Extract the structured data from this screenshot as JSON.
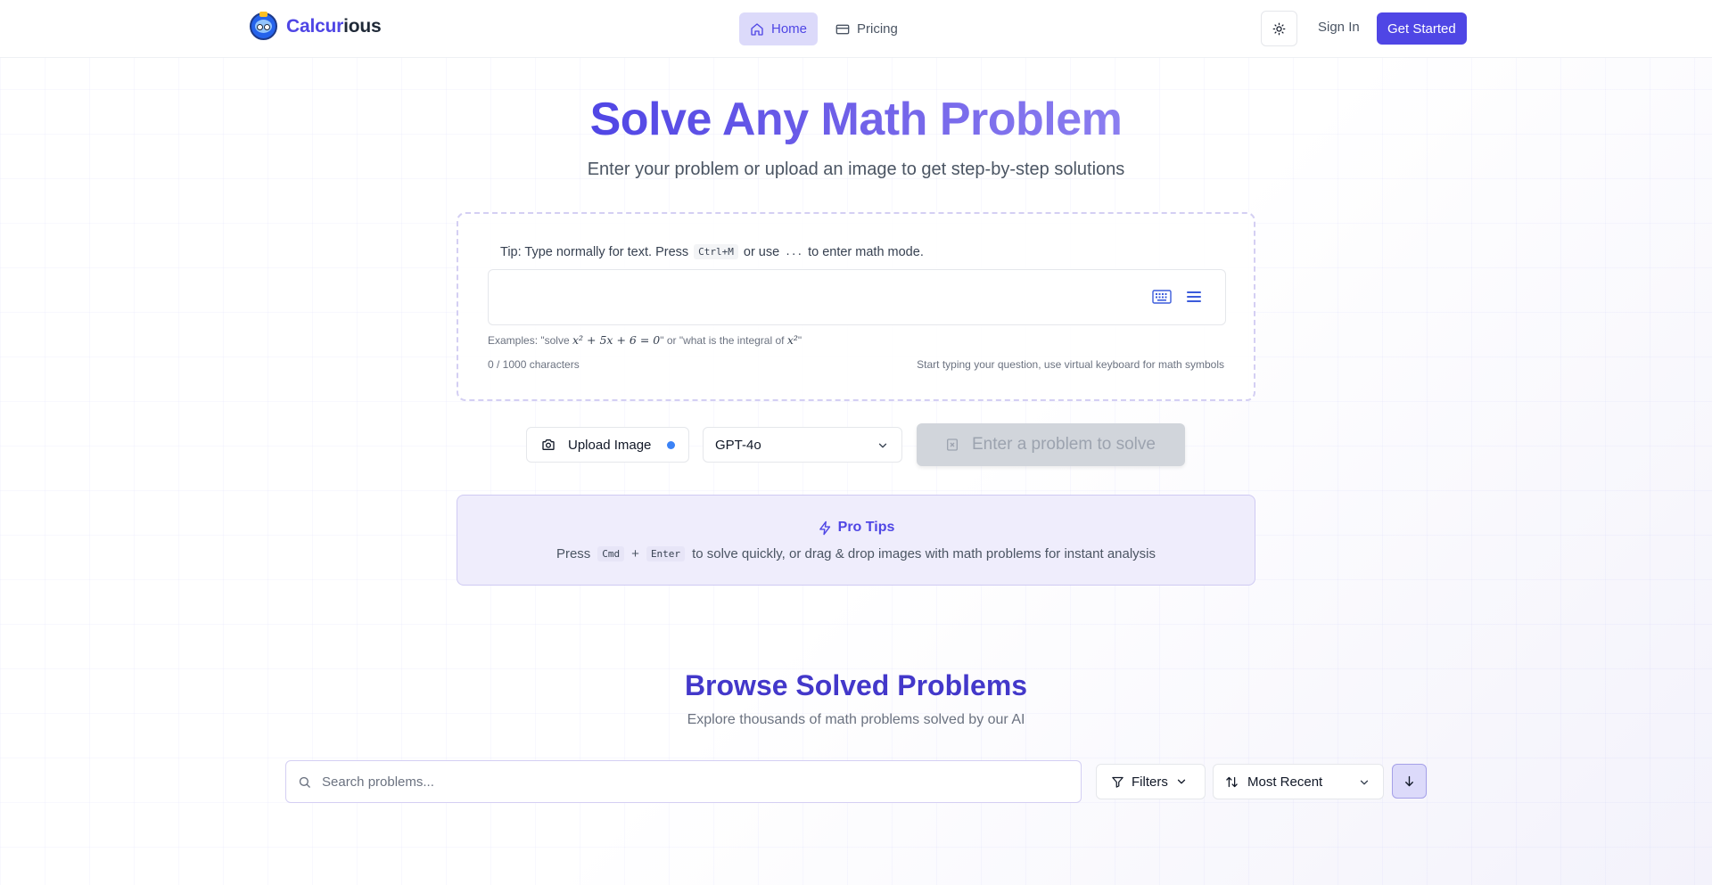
{
  "nav": {
    "brand_part1": "Calcur",
    "brand_part2": "ious",
    "links": [
      {
        "label": "Home",
        "icon": "home-icon",
        "active": true
      },
      {
        "label": "Pricing",
        "icon": "card-icon",
        "active": false
      }
    ],
    "theme_icon": "sun-icon",
    "signin_label": "Sign In",
    "get_started_label": "Get Started"
  },
  "hero": {
    "title": "Solve Any Math Problem",
    "subtitle": "Enter your problem or upload an image to get step-by-step solutions"
  },
  "input_card": {
    "tip_prefix": "Tip: Type normally for text. Press",
    "tip_key": "Ctrl+M",
    "tip_mid": "or use",
    "tip_key2": "...",
    "tip_suffix": "to enter math mode.",
    "examples_prefix": "Examples: \"solve",
    "examples_math1": "x² + 5x + 6 = 0",
    "examples_mid": "\" or \"what is the integral of",
    "examples_math2": "x²",
    "examples_suffix": "\"",
    "char_count": "0 / 1000 characters",
    "hint": "Start typing your question, use virtual keyboard for math symbols"
  },
  "actions": {
    "upload_label": "Upload Image",
    "model_selected": "GPT-4o",
    "solve_label": "Enter a problem to solve"
  },
  "pro_tips": {
    "title": "Pro Tips",
    "press": "Press",
    "key1": "Cmd",
    "plus": "+",
    "key2": "Enter",
    "text": "to solve quickly, or drag & drop images with math problems for instant analysis"
  },
  "browse": {
    "title": "Browse Solved Problems",
    "subtitle": "Explore thousands of math problems solved by our AI",
    "search_placeholder": "Search problems...",
    "filters_label": "Filters",
    "sort_selected": "Most Recent"
  },
  "colors": {
    "accent": "#4f46e5",
    "accent_soft": "#dcdafa",
    "upload_dot": "#3b82f6"
  }
}
